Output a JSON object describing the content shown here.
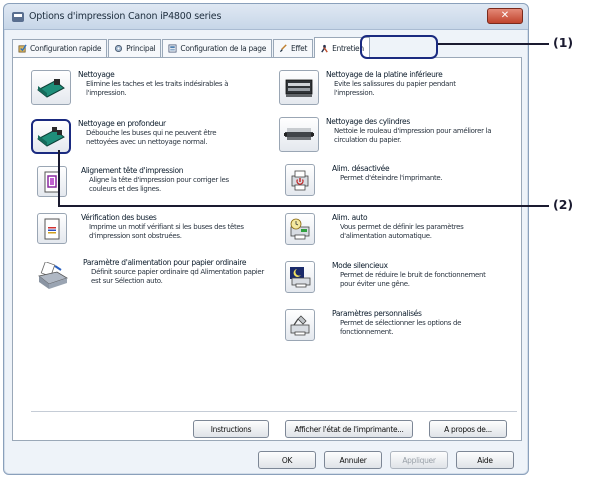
{
  "window": {
    "title": "Options d'impression Canon iP4800 series"
  },
  "tabs": [
    {
      "label": "Configuration rapide"
    },
    {
      "label": "Principal"
    },
    {
      "label": "Configuration de la page"
    },
    {
      "label": "Effet"
    },
    {
      "label": "Entretien"
    }
  ],
  "left_items": [
    {
      "name": "Nettoyage",
      "desc": "Elimine les taches et les traits indésirables à l'impression."
    },
    {
      "name": "Nettoyage en profondeur",
      "desc": "Débouche les buses qui ne peuvent être nettoyées avec un nettoyage normal."
    },
    {
      "name": "Alignement tête d'impression",
      "desc": "Aligne la tête d'impression pour corriger les couleurs et des lignes."
    },
    {
      "name": "Vérification des buses",
      "desc": "Imprime un motif vérifiant si les buses des têtes d'impression sont obstruées."
    },
    {
      "name": "Paramètre d'alimentation pour papier ordinaire",
      "desc": "Définit source papier ordinaire qd Alimentation papier est sur Sélection auto."
    }
  ],
  "right_items": [
    {
      "name": "Nettoyage de la platine inférieure",
      "desc": "Evite les salissures du papier pendant l'impression."
    },
    {
      "name": "Nettoyage des cylindres",
      "desc": "Nettoie le rouleau d'impression pour améliorer la circulation du papier."
    },
    {
      "name": "Alim. désactivée",
      "desc": "Permet d'éteindre l'imprimante."
    },
    {
      "name": "Alim. auto",
      "desc": "Vous permet de définir les paramètres d'alimentation automatique."
    },
    {
      "name": "Mode silencieux",
      "desc": "Permet de réduire le bruit de fonctionnement pour éviter une gêne."
    },
    {
      "name": "Paramètres personnalisés",
      "desc": "Permet de sélectionner les options de fonctionnement."
    }
  ],
  "panel_buttons": {
    "instructions": "Instructions",
    "status": "Afficher l'état de l'imprimante...",
    "about": "A propos de..."
  },
  "dialog_buttons": {
    "ok": "OK",
    "cancel": "Annuler",
    "apply": "Appliquer",
    "help": "Aide"
  },
  "callouts": {
    "one": "(1)",
    "two": "(2)"
  },
  "colors": {
    "accent": "#1a2a80",
    "teal": "#1f8f7a"
  }
}
